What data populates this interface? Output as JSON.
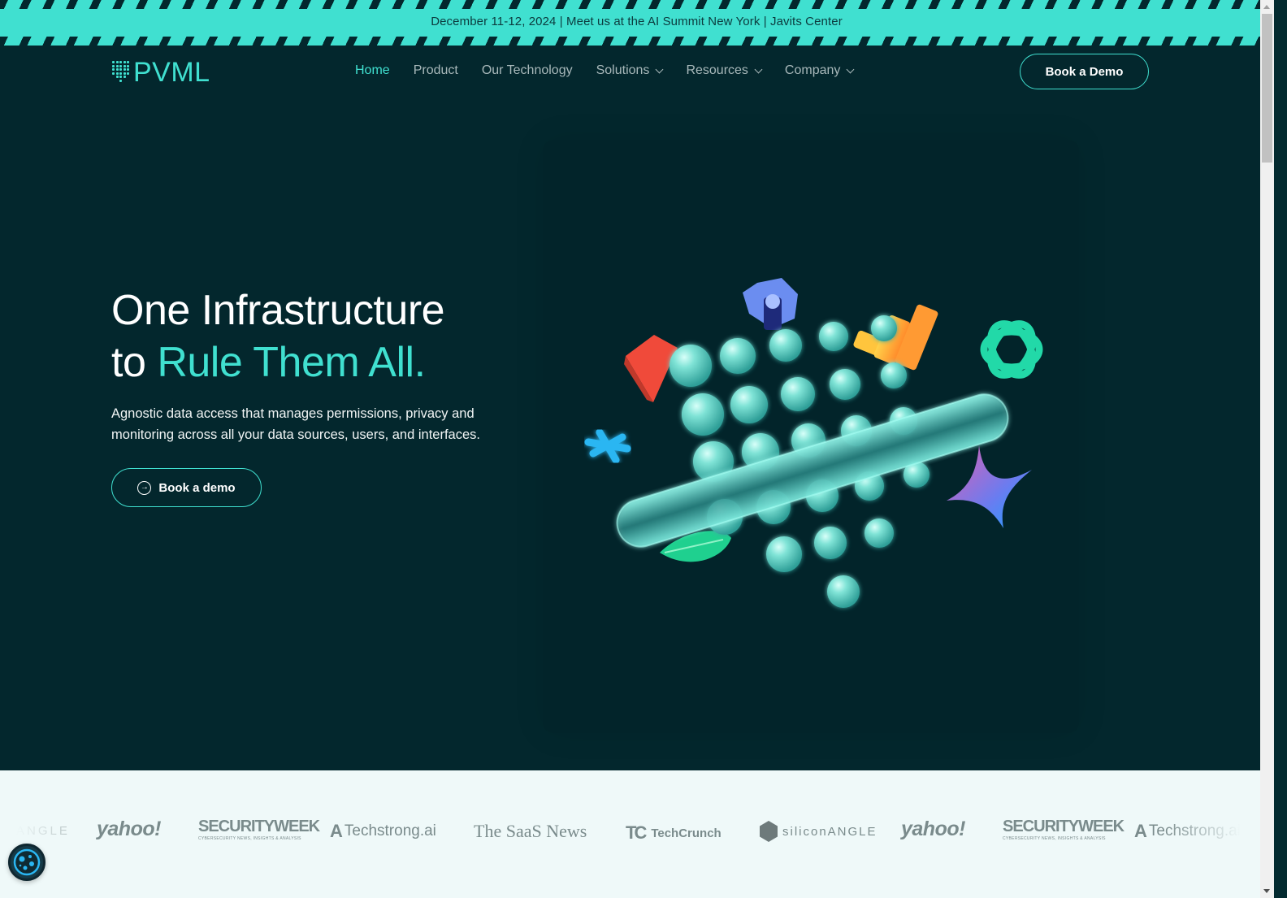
{
  "announcement": {
    "text": "December 11-12, 2024 | Meet us at the AI Summit New York | Javits Center"
  },
  "header": {
    "logo_text": "PVML",
    "nav": [
      {
        "label": "Home",
        "active": true,
        "dropdown": false
      },
      {
        "label": "Product",
        "active": false,
        "dropdown": false
      },
      {
        "label": "Our Technology",
        "active": false,
        "dropdown": false
      },
      {
        "label": "Solutions",
        "active": false,
        "dropdown": true
      },
      {
        "label": "Resources",
        "active": false,
        "dropdown": true
      },
      {
        "label": "Company",
        "active": false,
        "dropdown": true
      }
    ],
    "cta_label": "Book a Demo"
  },
  "hero": {
    "title_line1": "One Infrastructure",
    "title_line2_plain": "to ",
    "title_line2_accent": "Rule Them All.",
    "subtitle": "Agnostic data access that manages permissions, privacy and monitoring across all your data sources, users, and interfaces.",
    "button_label": "Book a demo",
    "button_icon": "arrow-right-circle-icon"
  },
  "press_logos": [
    {
      "name": "siliconANGLE",
      "text": "ANGLE"
    },
    {
      "name": "yahoo",
      "text": "yahoo!"
    },
    {
      "name": "SecurityWeek",
      "text": "SECURITYWEEK",
      "tagline": "CYBERSECURITY NEWS, INSIGHTS & ANALYSIS"
    },
    {
      "name": "Techstrong.ai",
      "text": "Techstrong.ai"
    },
    {
      "name": "The SaaS News",
      "text": "The SaaS News"
    },
    {
      "name": "TechCrunch",
      "text": "TechCrunch"
    },
    {
      "name": "siliconANGLE",
      "text": "siliconANGLE"
    },
    {
      "name": "yahoo",
      "text": "yahoo!"
    },
    {
      "name": "SecurityWeek",
      "text": "SECURITYWEEK",
      "tagline": "CYBERSECURITY NEWS, INSIGHTS & ANALYSIS"
    },
    {
      "name": "Techstrong.ai",
      "text": "Techstrong.ai"
    }
  ],
  "colors": {
    "accent": "#40e0d0",
    "background": "#03272d",
    "logos_bg": "#eff9f9",
    "logo_gray": "#7a8b8c"
  }
}
